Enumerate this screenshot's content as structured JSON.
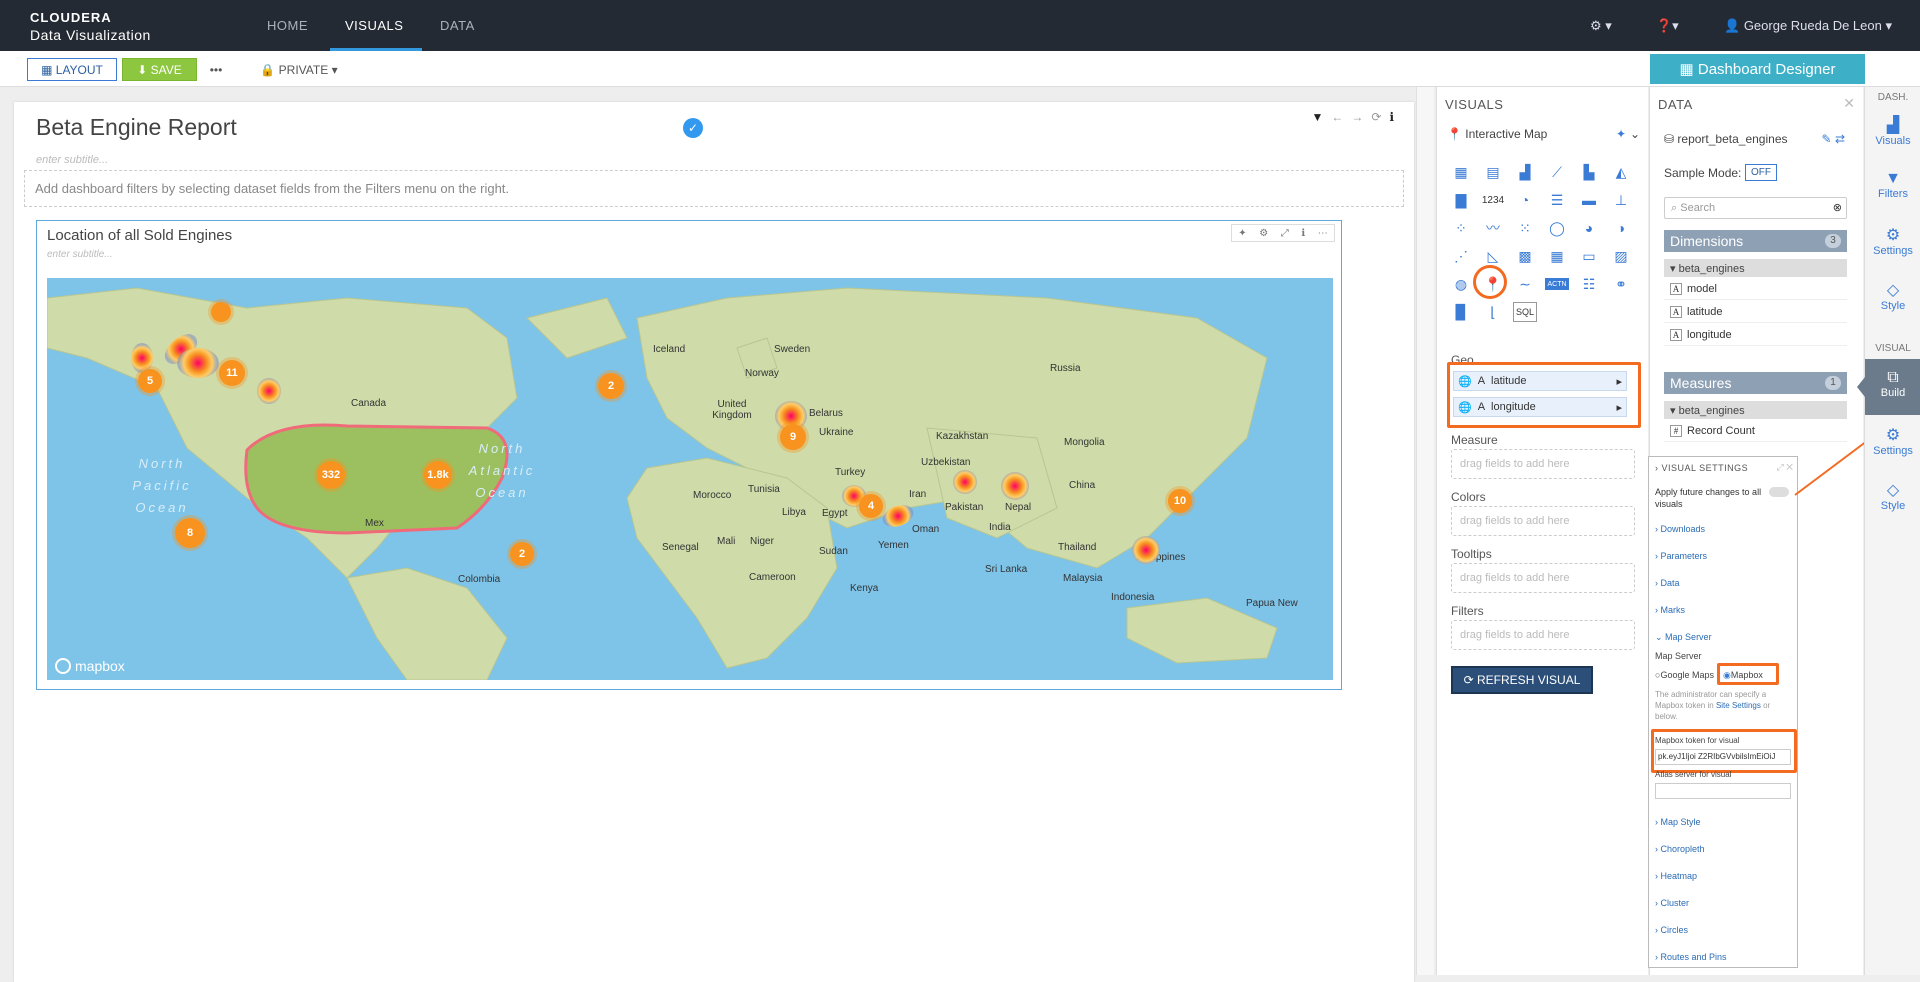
{
  "topnav": {
    "brand_line1": "CLOUDERA",
    "brand_line2": "Data Visualization",
    "tabs": [
      {
        "label": "HOME"
      },
      {
        "label": "VISUALS"
      },
      {
        "label": "DATA"
      }
    ],
    "settings_icon": "gear-icon",
    "help_icon": "question-icon",
    "user_name": "George Rueda De Leon"
  },
  "toolbar": {
    "layout_label": "LAYOUT",
    "save_label": "SAVE",
    "more_label": "•••",
    "privacy_label": "PRIVATE",
    "designer_label": "Dashboard Designer"
  },
  "dashboard": {
    "title": "Beta Engine Report",
    "subtitle_placeholder": "enter subtitle...",
    "filter_hint": "Add dashboard filters by selecting dataset fields from the Filters menu on the right."
  },
  "visual": {
    "title": "Location of all Sold Engines",
    "subtitle_placeholder": "enter subtitle...",
    "map": {
      "places": [
        "Iceland",
        "Sweden",
        "Norway",
        "Russia",
        "United Kingdom",
        "Belarus",
        "Ukraine",
        "Kazakhstan",
        "Mongolia",
        "Uzbekistan",
        "Turkey",
        "China",
        "Morocco",
        "Tunisia",
        "Iran",
        "Libya",
        "Egypt",
        "Pakistan",
        "Nepal",
        "India",
        "Oman",
        "Senegal",
        "Mali",
        "Niger",
        "Sudan",
        "Yemen",
        "Thailand",
        "Sri Lanka",
        "Malaysia",
        "Philippines",
        "Cameroon",
        "Kenya",
        "Indonesia",
        "Papua New",
        "Canada",
        "Colombia",
        "Mex"
      ],
      "oceans": [
        "North Pacific Ocean",
        "North Atlantic Ocean"
      ],
      "clusters": [
        "5",
        "11",
        "332",
        "1.8k",
        "8",
        "2",
        "2",
        "9",
        "4",
        "10"
      ],
      "attribution": "mapbox"
    }
  },
  "visuals_panel": {
    "header": "VISUALS",
    "selected_visual": "Interactive Map",
    "sql_label": "SQL",
    "numeric_label": "1234",
    "shelves": {
      "geo": "Geo",
      "geo_fields": [
        "latitude",
        "longitude"
      ],
      "measure": "Measure",
      "colors": "Colors",
      "tooltips": "Tooltips",
      "filters": "Filters",
      "drop_hint": "drag fields to add here"
    },
    "refresh_label": "REFRESH VISUAL"
  },
  "data_panel": {
    "header": "DATA",
    "dataset": "report_beta_engines",
    "sample_mode_label": "Sample Mode:",
    "sample_mode_value": "OFF",
    "search_placeholder": "Search",
    "dimensions_label": "Dimensions",
    "dimensions_count": "3",
    "dimensions_group": "beta_engines",
    "dimensions": [
      "model",
      "latitude",
      "longitude"
    ],
    "measures_label": "Measures",
    "measures_count": "1",
    "measures_group": "beta_engines",
    "measures": [
      "Record Count"
    ]
  },
  "visual_settings": {
    "header": "VISUAL SETTINGS",
    "apply_label": "Apply future changes to all visuals",
    "sections": [
      "Downloads",
      "Parameters",
      "Data",
      "Marks"
    ],
    "map_server_section": "Map Server",
    "map_server_label": "Map Server",
    "option_google": "Google Maps",
    "option_mapbox": "Mapbox",
    "admin_note_pre": "The administrator can specify a Mapbox token in ",
    "admin_note_link": "Site Settings",
    "admin_note_post": " or below.",
    "token_label": "Mapbox token for visual",
    "token_value": "pk.eyJ1Ijoi Z2RIbGVvbilsImEiOiJ",
    "atlas_label": "Atlas server for visual",
    "more_sections": [
      "Map Style",
      "Choropleth",
      "Heatmap",
      "Cluster",
      "Circles",
      "Routes and Pins"
    ]
  },
  "sidebar": {
    "dash_title": "DASH.",
    "dash_items": [
      "Visuals",
      "Filters",
      "Settings",
      "Style"
    ],
    "visual_title": "VISUAL",
    "visual_items": [
      "Build",
      "Settings",
      "Style"
    ]
  },
  "colors": {
    "accent": "#3a7bd5",
    "highlight": "#f26b21",
    "nav": "#232a33",
    "save": "#8dc63f",
    "cluster": "#f7931e",
    "land": "#c8d8a0"
  }
}
